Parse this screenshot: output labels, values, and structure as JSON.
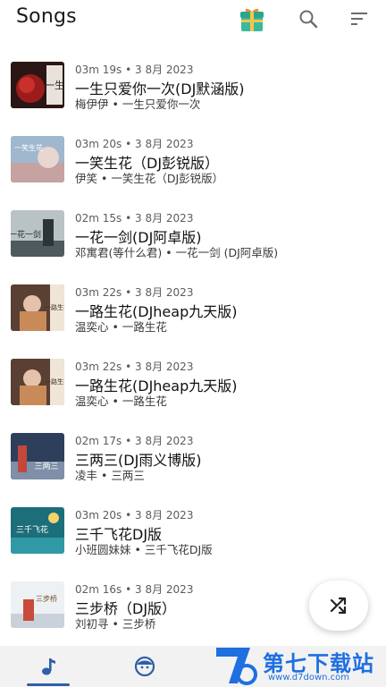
{
  "header": {
    "title": "Songs",
    "icons": [
      "gift-icon",
      "search-icon",
      "sort-icon"
    ]
  },
  "songs": [
    {
      "duration": "03m 19s",
      "date": "3 8月 2023",
      "title": "一生只爱你一次(DJ默涵版)",
      "artist": "梅伊伊",
      "album": "一生只爱你一次",
      "cover_text": "一生"
    },
    {
      "duration": "03m 20s",
      "date": "3 8月 2023",
      "title": "一笑生花（DJ彭锐版）",
      "artist": "伊笑",
      "album": "一笑生花（DJ彭锐版）",
      "cover_text": "一笑生花"
    },
    {
      "duration": "02m 15s",
      "date": "3 8月 2023",
      "title": "一花一剑(DJ阿卓版)",
      "artist": "邓寓君(等什么君)",
      "album": "一花一剑 (DJ阿卓版)",
      "cover_text": "一花一剑"
    },
    {
      "duration": "03m 22s",
      "date": "3 8月 2023",
      "title": "一路生花(DJheap九天版)",
      "artist": "温奕心",
      "album": "一路生花",
      "cover_text": "一路生花"
    },
    {
      "duration": "03m 22s",
      "date": "3 8月 2023",
      "title": "一路生花(DJheap九天版)",
      "artist": "温奕心",
      "album": "一路生花",
      "cover_text": "一路生花"
    },
    {
      "duration": "02m 17s",
      "date": "3 8月 2023",
      "title": "三两三(DJ雨义博版)",
      "artist": "凌丰",
      "album": "三两三",
      "cover_text": "三两三"
    },
    {
      "duration": "03m 20s",
      "date": "3 8月 2023",
      "title": "三千飞花DJ版",
      "artist": "小班圆妹妹",
      "album": "三千飞花DJ版",
      "cover_text": "三千飞花"
    },
    {
      "duration": "02m 16s",
      "date": "3 8月 2023",
      "title": "三步桥（DJ版）",
      "artist": "刘初寻",
      "album": "三步桥",
      "cover_text": "三步桥"
    }
  ],
  "fab": {
    "icon": "shuffle-icon"
  },
  "bottom_nav": {
    "items": [
      {
        "icon": "music-note-icon",
        "active": true
      },
      {
        "icon": "artist-face-icon",
        "active": false
      }
    ],
    "accent": "#2f5fa8"
  },
  "watermark": {
    "text": "第七下载站",
    "url": "www.d7down.com"
  }
}
